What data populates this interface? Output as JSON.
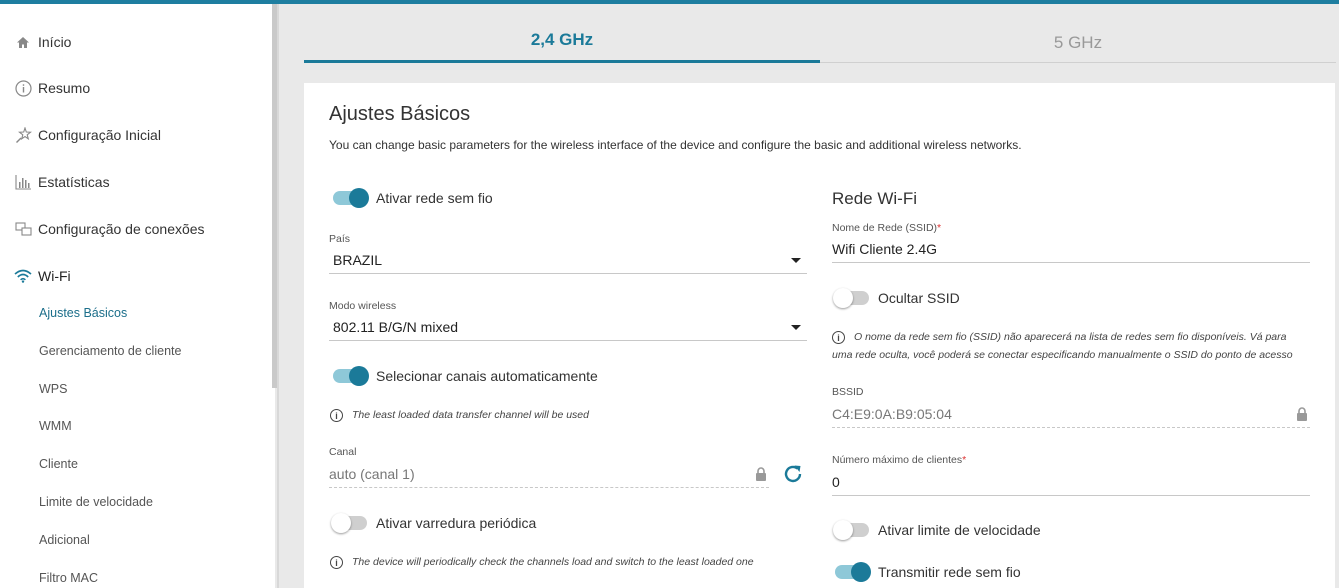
{
  "sidebar": {
    "items": [
      {
        "label": "Início",
        "icon": "home-icon"
      },
      {
        "label": "Resumo",
        "icon": "info-icon"
      },
      {
        "label": "Configuração Inicial",
        "icon": "wizard-icon"
      },
      {
        "label": "Estatísticas",
        "icon": "chart-icon"
      },
      {
        "label": "Configuração de conexões",
        "icon": "connections-icon"
      },
      {
        "label": "Wi-Fi",
        "icon": "wifi-icon"
      }
    ],
    "subitems": [
      "Ajustes Básicos",
      "Gerenciamento de cliente",
      "WPS",
      "WMM",
      "Cliente",
      "Limite de velocidade",
      "Adicional",
      "Filtro MAC"
    ],
    "active_subitem": "Ajustes Básicos"
  },
  "tabs": {
    "band24": "2,4 GHz",
    "band5": "5 GHz",
    "active": "2,4 GHz"
  },
  "page": {
    "title": "Ajustes Básicos",
    "description": "You can change basic parameters for the wireless interface of the device and configure the basic and additional wireless networks."
  },
  "left": {
    "enable_wireless": {
      "label": "Ativar rede sem fio",
      "on": true
    },
    "country": {
      "label": "País",
      "value": "BRAZIL"
    },
    "mode": {
      "label": "Modo wireless",
      "value": "802.11 B/G/N mixed"
    },
    "auto_channel": {
      "label": "Selecionar canais automaticamente",
      "on": true
    },
    "auto_channel_hint": "The least loaded data transfer channel will be used",
    "channel": {
      "label": "Canal",
      "value": "auto (canal 1)"
    },
    "periodic_scan": {
      "label": "Ativar varredura periódica",
      "on": false
    },
    "periodic_scan_hint": "The device will periodically check the channels load and switch to the least loaded one"
  },
  "right": {
    "title": "Rede Wi-Fi",
    "ssid": {
      "label": "Nome de Rede (SSID)",
      "required": "*",
      "value": "Wifi Cliente 2.4G"
    },
    "hide_ssid": {
      "label": "Ocultar SSID",
      "on": false
    },
    "hide_ssid_hint_line1": "O nome da rede sem fio (SSID) não aparecerá na lista de redes sem fio disponíveis. Vá para",
    "hide_ssid_hint_line2": "uma rede oculta, você poderá se conectar especificando manualmente o SSID do ponto de acesso",
    "bssid": {
      "label": "BSSID",
      "value": "C4:E9:0A:B9:05:04"
    },
    "max_clients": {
      "label": "Número máximo de clientes",
      "required": "*",
      "value": "0"
    },
    "speed_limit": {
      "label": "Ativar limite de velocidade",
      "on": false
    },
    "broadcast": {
      "label": "Transmitir rede sem fio",
      "on": true
    }
  },
  "colors": {
    "accent": "#1b7a99",
    "toggle_track_on": "#8ec8d8",
    "toggle_off": "#cfcfcf",
    "required": "#d33333"
  }
}
